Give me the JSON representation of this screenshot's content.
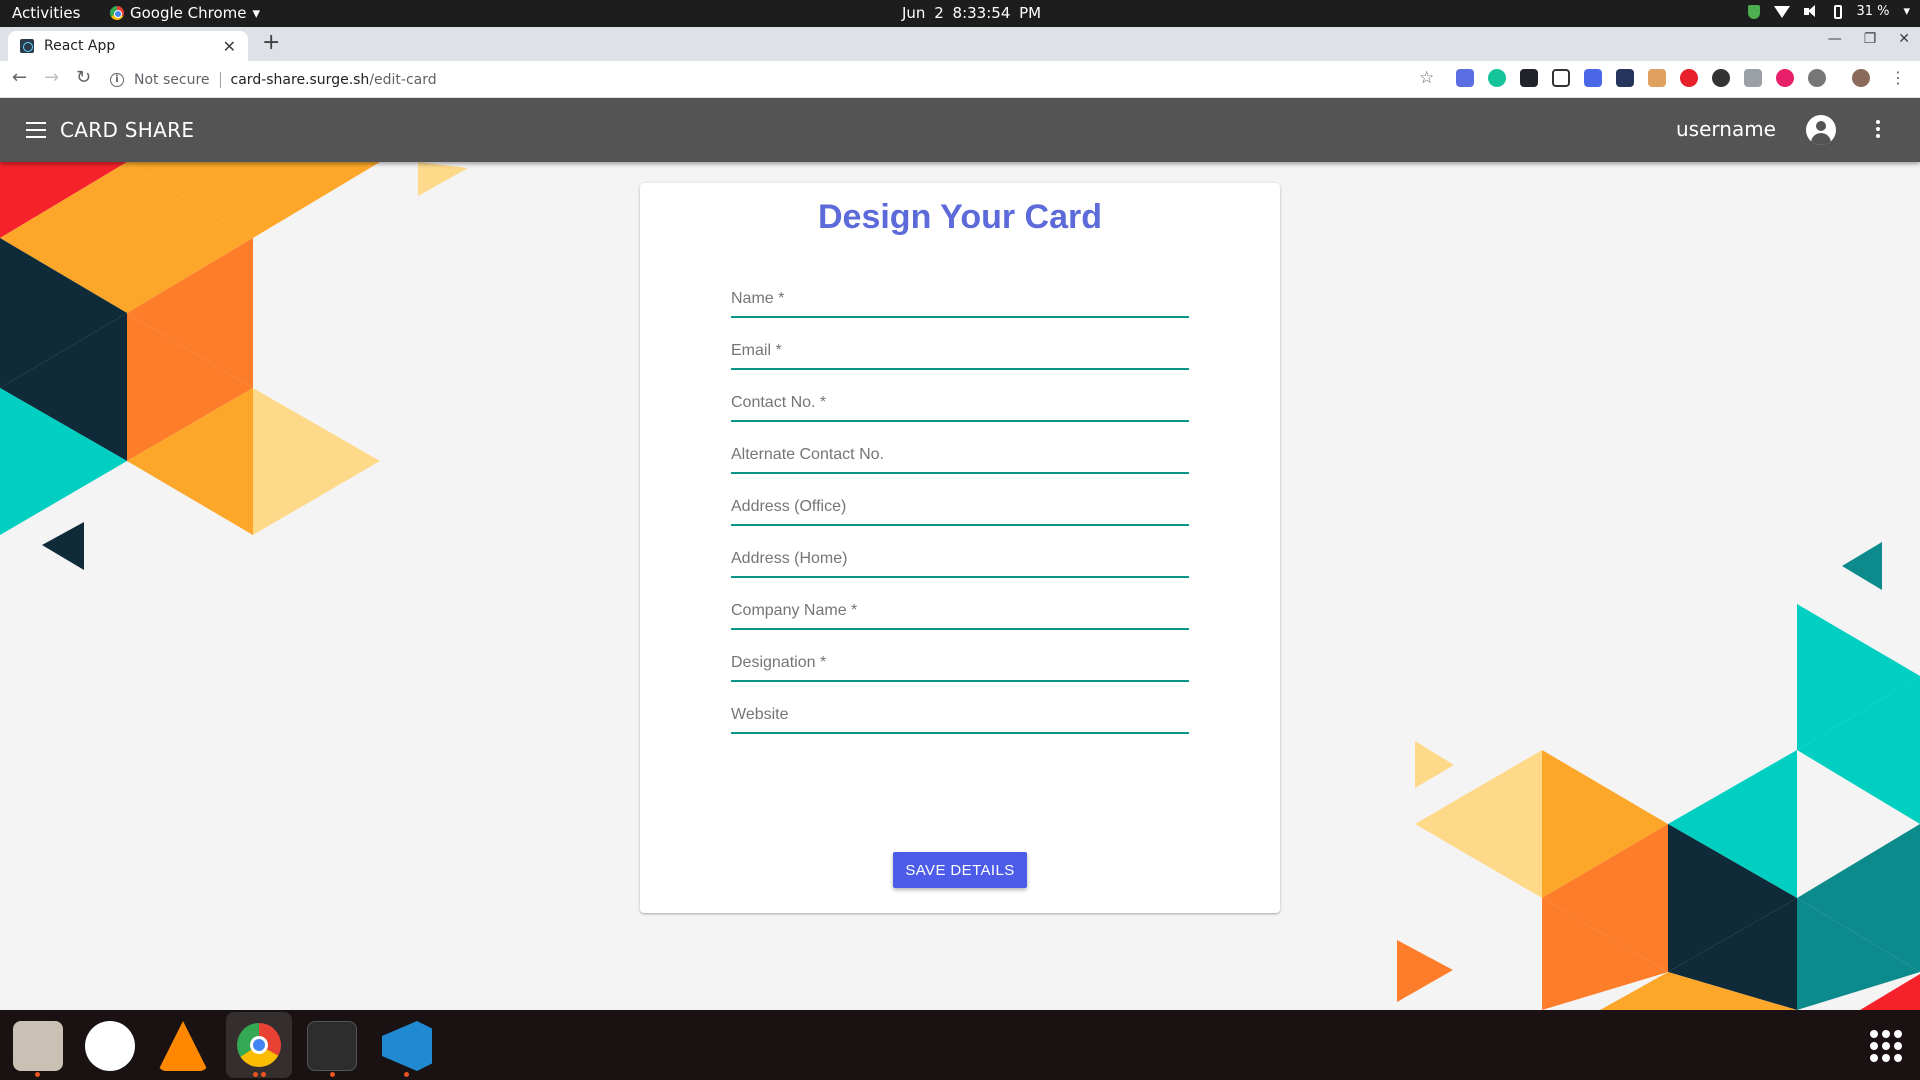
{
  "system_bar": {
    "activities": "Activities",
    "app_name": "Google Chrome",
    "date": "Jun 2",
    "time": "8:33:54 PM",
    "battery": "31 %"
  },
  "browser": {
    "tab_title": "React App",
    "security_label": "Not secure",
    "url_host": "card-share.surge.sh",
    "url_path": "/edit-card"
  },
  "app": {
    "brand": "CARD SHARE",
    "username": "username",
    "form": {
      "title": "Design Your Card",
      "fields": [
        {
          "placeholder": "Name *",
          "value": ""
        },
        {
          "placeholder": "Email *",
          "value": ""
        },
        {
          "placeholder": "Contact No. *",
          "value": ""
        },
        {
          "placeholder": "Alternate Contact No.",
          "value": ""
        },
        {
          "placeholder": "Address (Office)",
          "value": ""
        },
        {
          "placeholder": "Address (Home)",
          "value": ""
        },
        {
          "placeholder": "Company Name *",
          "value": ""
        },
        {
          "placeholder": "Designation *",
          "value": ""
        },
        {
          "placeholder": "Website",
          "value": ""
        }
      ],
      "save_label": "SAVE DETAILS"
    }
  },
  "colors": {
    "appbar": "#545454",
    "title": "#5c6bd9",
    "underline": "#0d9488",
    "button": "#4c5ce8"
  },
  "dock": {
    "apps": [
      "files-icon",
      "slack-icon",
      "vlc-icon",
      "chrome-icon",
      "terminal-icon",
      "vscode-icon"
    ]
  }
}
